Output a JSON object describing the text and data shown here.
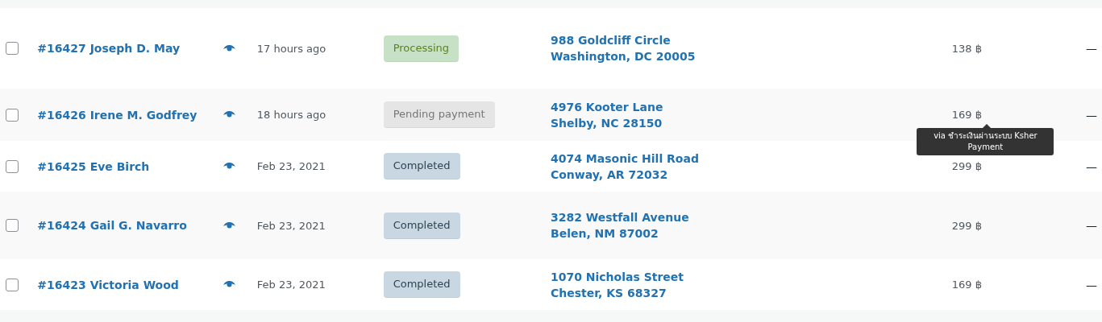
{
  "orders": [
    {
      "selected": false,
      "order": "#16427 Joseph D. May",
      "date": "17 hours ago",
      "status": {
        "label": "Processing",
        "kind": "processing"
      },
      "address": [
        "988 Goldcliff Circle",
        "Washington, DC 20005"
      ],
      "total": "138 ฿",
      "action": "—"
    },
    {
      "selected": false,
      "order": "#16426 Irene M. Godfrey",
      "date": "18 hours ago",
      "status": {
        "label": "Pending payment",
        "kind": "pending"
      },
      "address": [
        "4976 Kooter Lane",
        "Shelby, NC 28150"
      ],
      "total": "169 ฿",
      "action": "—",
      "tooltip": "via ชำระเงินผ่านระบบ Ksher Payment"
    },
    {
      "selected": false,
      "order": "#16425 Eve Birch",
      "date": "Feb 23, 2021",
      "status": {
        "label": "Completed",
        "kind": "completed"
      },
      "address": [
        "4074 Masonic Hill Road",
        "Conway, AR 72032"
      ],
      "total": "299 ฿",
      "action": "—"
    },
    {
      "selected": false,
      "order": "#16424 Gail G. Navarro",
      "date": "Feb 23, 2021",
      "status": {
        "label": "Completed",
        "kind": "completed"
      },
      "address": [
        "3282 Westfall Avenue",
        "Belen, NM 87002"
      ],
      "total": "299 ฿",
      "action": "—"
    },
    {
      "selected": false,
      "order": "#16423 Victoria Wood",
      "date": "Feb 23, 2021",
      "status": {
        "label": "Completed",
        "kind": "completed"
      },
      "address": [
        "1070 Nicholas Street",
        "Chester, KS 68327"
      ],
      "total": "169 ฿",
      "action": "—"
    }
  ]
}
